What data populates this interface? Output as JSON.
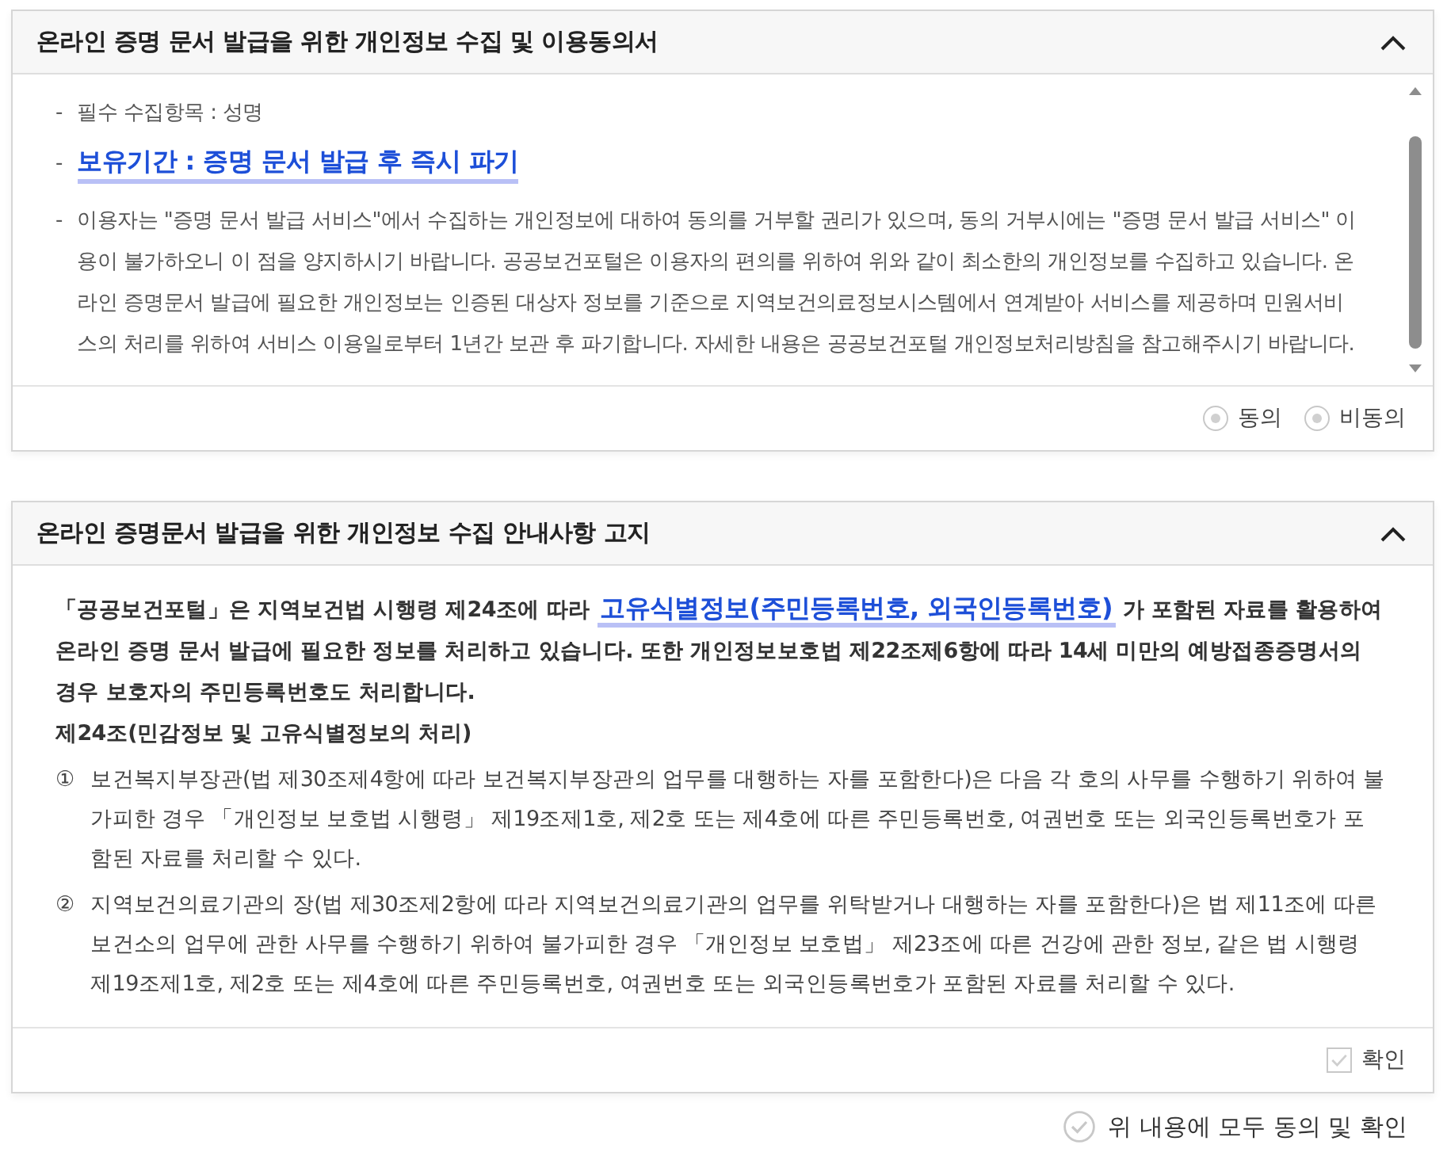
{
  "consent_panel": {
    "title": "온라인 증명 문서 발급을 위한 개인정보 수집 및 이용동의서",
    "expanded": true,
    "items": [
      {
        "kind": "plain",
        "marker": "-",
        "text": "필수 수집항목 : 성명"
      },
      {
        "kind": "highlight",
        "marker": "-",
        "text": "보유기간 : 증명 문서 발급 후 즉시 파기"
      },
      {
        "kind": "plain",
        "marker": "-",
        "text": "이용자는 \"증명 문서 발급 서비스\"에서 수집하는 개인정보에 대하여 동의를 거부할 권리가 있으며, 동의 거부시에는 \"증명 문서 발급 서비스\" 이용이 불가하오니 이 점을 양지하시기 바랍니다. 공공보건포털은 이용자의 편의를 위하여 위와 같이 최소한의 개인정보를 수집하고 있습니다. 온라인 증명문서 발급에 필요한 개인정보는 인증된 대상자 정보를 기준으로 지역보건의료정보시스템에서 연계받아 서비스를 제공하며 민원서비스의 처리를 위하여 서비스 이용일로부터 1년간 보관 후 파기합니다. 자세한 내용은 공공보건포털 개인정보처리방침을 참고해주시기 바랍니다."
      }
    ],
    "options": [
      {
        "label": "동의",
        "selected": false
      },
      {
        "label": "비동의",
        "selected": false
      }
    ]
  },
  "notice_panel": {
    "title": "온라인 증명문서 발급을 위한 개인정보 수집 안내사항 고지",
    "expanded": true,
    "intro": {
      "before": "「공공보건포털」은 지역보건법 시행령 제24조에 따라",
      "link": "고유식별정보(주민등록번호, 외국인등록번호)",
      "after": "가 포함된 자료를 활용하여 온라인 증명 문서 발급에 필요한 정보를 처리하고 있습니다. 또한 개인정보보호법 제22조제6항에 따라 14세 미만의 예방접종증명서의 경우 보호자의 주민등록번호도 처리합니다."
    },
    "article_title": "제24조(민감정보 및 고유식별정보의 처리)",
    "clauses": [
      {
        "marker": "①",
        "text": "보건복지부장관(법 제30조제4항에 따라 보건복지부장관의 업무를 대행하는 자를 포함한다)은 다음 각 호의 사무를 수행하기 위하여 불가피한 경우 「개인정보 보호법 시행령」 제19조제1호, 제2호 또는 제4호에 따른 주민등록번호, 여권번호 또는 외국인등록번호가 포함된 자료를 처리할 수 있다."
      },
      {
        "marker": "②",
        "text": "지역보건의료기관의 장(법 제30조제2항에 따라 지역보건의료기관의 업무를 위탁받거나 대행하는 자를 포함한다)은 법 제11조에 따른 보건소의 업무에 관한 사무를 수행하기 위하여 불가피한 경우 「개인정보 보호법」 제23조에 따른 건강에 관한 정보, 같은 법 시행령 제19조제1호, 제2호 또는 제4호에 따른 주민등록번호, 여권번호 또는 외국인등록번호가 포함된 자료를 처리할 수 있다."
      }
    ],
    "confirm": {
      "label": "확인",
      "checked": false
    }
  },
  "agree_all": {
    "label": "위 내용에 모두 동의 및 확인",
    "checked": false
  }
}
